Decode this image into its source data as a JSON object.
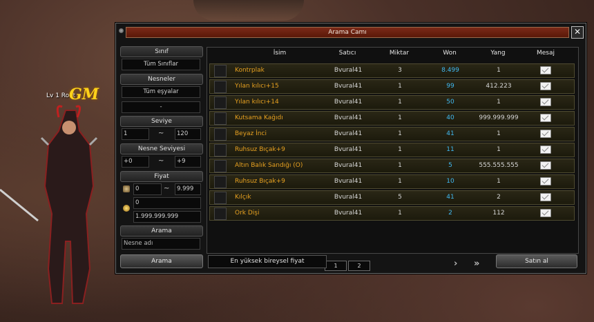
{
  "hud": {
    "level_text": "Lv 1 Root",
    "gm_badge": "GM"
  },
  "window": {
    "title": "Arama Camı",
    "close_label": "✕"
  },
  "filters": {
    "class_header": "Sınıf",
    "class_value": "Tüm Sınıflar",
    "items_header": "Nesneler",
    "items_value": "Tüm eşyalar",
    "items_sub_value": "-",
    "level_header": "Seviye",
    "level_min": "1",
    "level_max": "120",
    "item_level_header": "Nesne Seviyesi",
    "item_level_min": "+0",
    "item_level_max": "+9",
    "price_header": "Fiyat",
    "won_min": "0",
    "won_max": "9.999",
    "yang_min": "0",
    "yang_max": "1.999.999.999",
    "search_header": "Arama",
    "search_placeholder": "Nesne adı",
    "search_button": "Arama",
    "tilde": "~"
  },
  "table": {
    "headers": {
      "name": "İsim",
      "seller": "Satıcı",
      "quantity": "Miktar",
      "won": "Won",
      "yang": "Yang",
      "message": "Mesaj"
    },
    "rows": [
      {
        "name": "Kontrplak",
        "seller": "Bvural41",
        "quantity": "3",
        "won": "8.499",
        "yang": "1"
      },
      {
        "name": "Yılan kılıcı+15",
        "seller": "Bvural41",
        "quantity": "1",
        "won": "99",
        "yang": "412.223"
      },
      {
        "name": "Yılan kılıcı+14",
        "seller": "Bvural41",
        "quantity": "1",
        "won": "50",
        "yang": "1"
      },
      {
        "name": "Kutsama Kağıdı",
        "seller": "Bvural41",
        "quantity": "1",
        "won": "40",
        "yang": "999.999.999"
      },
      {
        "name": "Beyaz İnci",
        "seller": "Bvural41",
        "quantity": "1",
        "won": "41",
        "yang": "1"
      },
      {
        "name": "Ruhsuz Bıçak+9",
        "seller": "Bvural41",
        "quantity": "1",
        "won": "11",
        "yang": "1"
      },
      {
        "name": "Altın Balık Sandığı (O)",
        "seller": "Bvural41",
        "quantity": "1",
        "won": "5",
        "yang": "555.555.555"
      },
      {
        "name": "Ruhsuz Bıçak+9",
        "seller": "Bvural41",
        "quantity": "1",
        "won": "10",
        "yang": "1"
      },
      {
        "name": "Kılçık",
        "seller": "Bvural41",
        "quantity": "5",
        "won": "41",
        "yang": "2"
      },
      {
        "name": "Ork Dişi",
        "seller": "Bvural41",
        "quantity": "1",
        "won": "2",
        "yang": "112"
      }
    ]
  },
  "pager": {
    "first": "«",
    "prev": "‹",
    "next": "›",
    "last": "»",
    "pages": [
      "1",
      "2"
    ]
  },
  "footer": {
    "hint": "En yüksek bireysel fiyat",
    "buy_button": "Satın al"
  },
  "colors": {
    "item_name": "#e6a020",
    "won_value": "#40b8f0",
    "title_bar": "#6a2010"
  },
  "icons": {
    "message": "envelope-icon",
    "won_currency": "won-coin-icon",
    "yang_currency": "yang-coin-icon"
  }
}
